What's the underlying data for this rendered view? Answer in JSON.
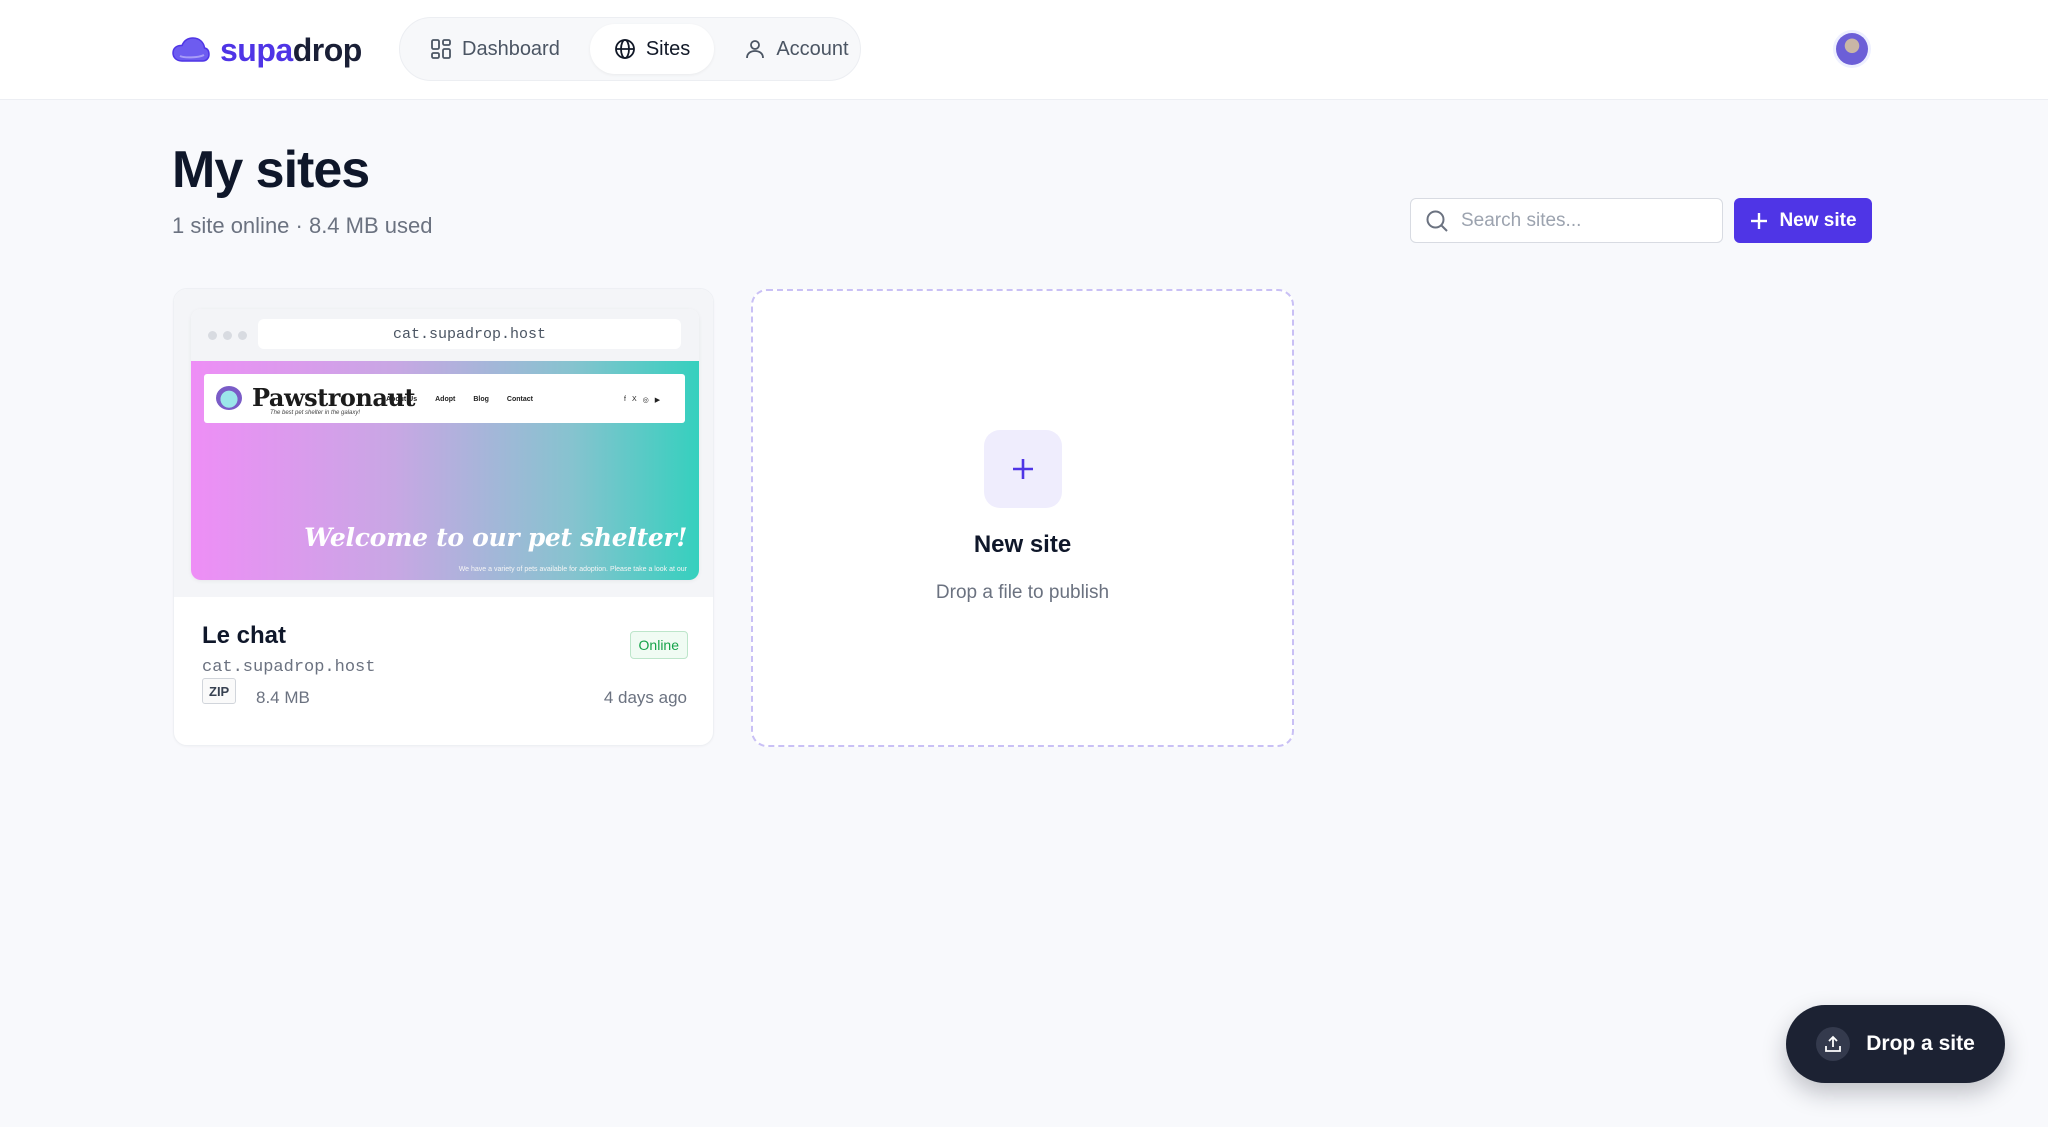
{
  "brand": {
    "part1": "supa",
    "part2": "drop",
    "accent": "#4f35e6"
  },
  "nav": {
    "items": [
      {
        "label": "Dashboard",
        "icon": "dashboard-grid-icon",
        "active": false
      },
      {
        "label": "Sites",
        "icon": "globe-icon",
        "active": true
      },
      {
        "label": "Account",
        "icon": "user-icon",
        "active": false
      }
    ]
  },
  "header": {
    "title": "My sites",
    "subtitle": "1 site online · 8.4 MB used"
  },
  "search": {
    "placeholder": "Search sites...",
    "value": ""
  },
  "actions": {
    "new_site_label": "New site",
    "drop_label": "Drop a site"
  },
  "sites": [
    {
      "name": "Le chat",
      "domain": "cat.supadrop.host",
      "status": "Online",
      "type": "ZIP",
      "size": "8.4 MB",
      "updated": "4 days ago",
      "preview": {
        "url": "cat.supadrop.host",
        "brand": "Pawstronaut",
        "tagline": "The best pet shelter in the galaxy!",
        "links": [
          "About Us",
          "Adopt",
          "Blog",
          "Contact"
        ],
        "social": [
          "f",
          "X",
          "◎",
          "▶"
        ],
        "hero": "Welcome to our pet shelter!",
        "hero_text": "We have a variety of pets available for adoption. Please take a look at our"
      }
    }
  ],
  "new_card": {
    "title": "New site",
    "subtitle": "Drop a file to publish"
  }
}
